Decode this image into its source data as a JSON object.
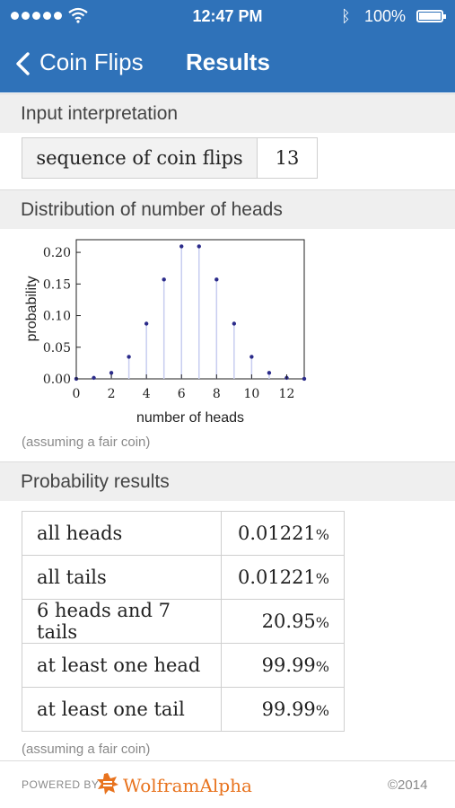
{
  "status_bar": {
    "time": "12:47 PM",
    "battery": "100%"
  },
  "nav": {
    "back_label": "Coin Flips",
    "title": "Results"
  },
  "sections": {
    "input": "Input interpretation",
    "distribution": "Distribution of number of heads",
    "probability": "Probability results"
  },
  "input_interpretation": {
    "key": "sequence of coin flips",
    "value": "13"
  },
  "chart_data": {
    "type": "scatter",
    "style": "stem plot",
    "xlabel": "number of heads",
    "ylabel": "probability",
    "xlim": [
      0,
      13
    ],
    "ylim": [
      0,
      0.22
    ],
    "x_ticks": [
      "0",
      "2",
      "4",
      "6",
      "8",
      "10",
      "12"
    ],
    "y_ticks": [
      "0.00",
      "0.05",
      "0.10",
      "0.15",
      "0.20"
    ],
    "x": [
      0,
      1,
      2,
      3,
      4,
      5,
      6,
      7,
      8,
      9,
      10,
      11,
      12,
      13
    ],
    "values": [
      0.0001,
      0.0016,
      0.0095,
      0.0349,
      0.0873,
      0.1571,
      0.2095,
      0.2095,
      0.1571,
      0.0873,
      0.0349,
      0.0095,
      0.0016,
      0.0001
    ],
    "colors": {
      "point": "#2b2b8a",
      "stem": "#c8cdf0"
    }
  },
  "notes": {
    "fair_coin_1": "(assuming a fair coin)",
    "fair_coin_2": "(assuming a fair coin)"
  },
  "results": [
    {
      "label": "all heads",
      "value": "0.01221",
      "unit": "%"
    },
    {
      "label": "all tails",
      "value": "0.01221",
      "unit": "%"
    },
    {
      "label": "6 heads and 7 tails",
      "value": "20.95",
      "unit": "%"
    },
    {
      "label": "at least one head",
      "value": "99.99",
      "unit": "%"
    },
    {
      "label": "at least one tail",
      "value": "99.99",
      "unit": "%"
    }
  ],
  "footer": {
    "powered_by": "POWERED BY",
    "brand": "WolframAlpha",
    "copyright": "©2014"
  },
  "colors": {
    "header": "#2f72b9",
    "brand": "#e8731e"
  }
}
